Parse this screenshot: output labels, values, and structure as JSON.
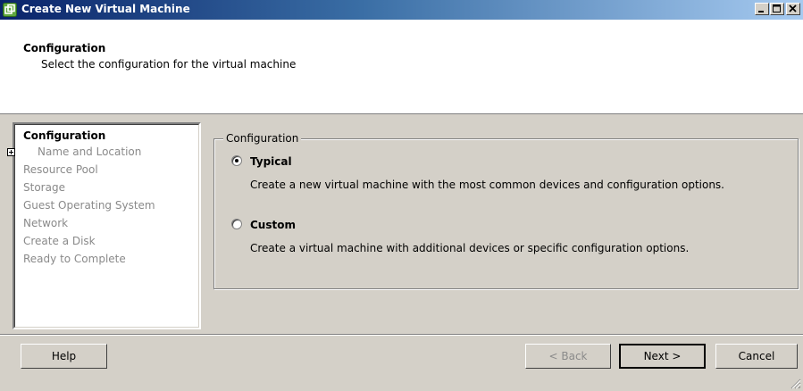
{
  "window": {
    "title": "Create New Virtual Machine",
    "controls": {
      "minimize": "_",
      "maximize": "□",
      "close": "✕"
    }
  },
  "header": {
    "title": "Configuration",
    "subtitle": "Select the configuration for the virtual machine"
  },
  "steps": [
    {
      "label": "Configuration",
      "active": true
    },
    {
      "label": "Name and Location",
      "active": false
    },
    {
      "label": "Resource Pool",
      "active": false
    },
    {
      "label": "Storage",
      "active": false
    },
    {
      "label": "Guest Operating System",
      "active": false
    },
    {
      "label": "Network",
      "active": false
    },
    {
      "label": "Create a Disk",
      "active": false
    },
    {
      "label": "Ready to Complete",
      "active": false
    }
  ],
  "configuration": {
    "legend": "Configuration",
    "options": [
      {
        "label": "Typical",
        "description": "Create a new virtual machine with the most common devices and configuration options.",
        "selected": true
      },
      {
        "label": "Custom",
        "description": "Create a virtual machine with additional devices or specific configuration options.",
        "selected": false
      }
    ]
  },
  "buttons": {
    "help": "Help",
    "back": "< Back",
    "next": "Next >",
    "cancel": "Cancel"
  },
  "icons": {
    "app": "vmware-app-icon",
    "expander": "plus-box-icon",
    "grip": "resize-grip-icon"
  },
  "colors": {
    "title_bar_start": "#0a246a",
    "title_bar_end": "#a6caf0",
    "window_face": "#d4d0c8",
    "disabled_text": "#8a8a8a"
  }
}
